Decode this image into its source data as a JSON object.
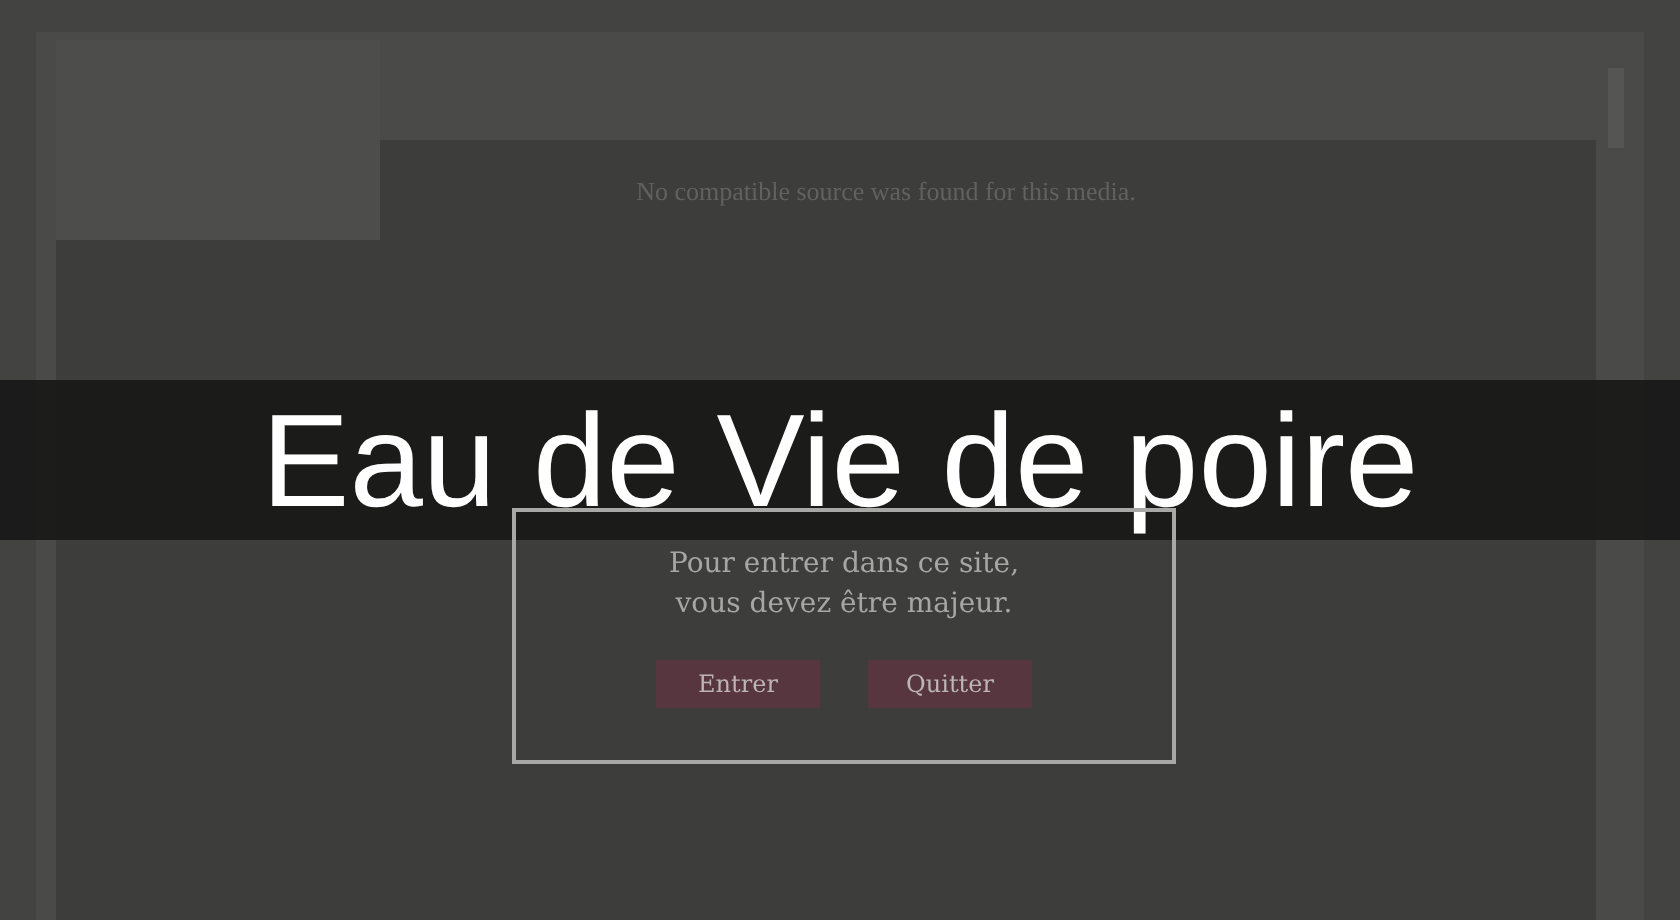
{
  "media": {
    "message": "No compatible source was found for this media."
  },
  "banner": {
    "title": "Eau de Vie de poire"
  },
  "age_gate": {
    "message": "Pour entrer dans ce site,\nvous devez être majeur.",
    "buttons": [
      {
        "label": "Entrer"
      },
      {
        "label": "Quitter"
      }
    ]
  }
}
